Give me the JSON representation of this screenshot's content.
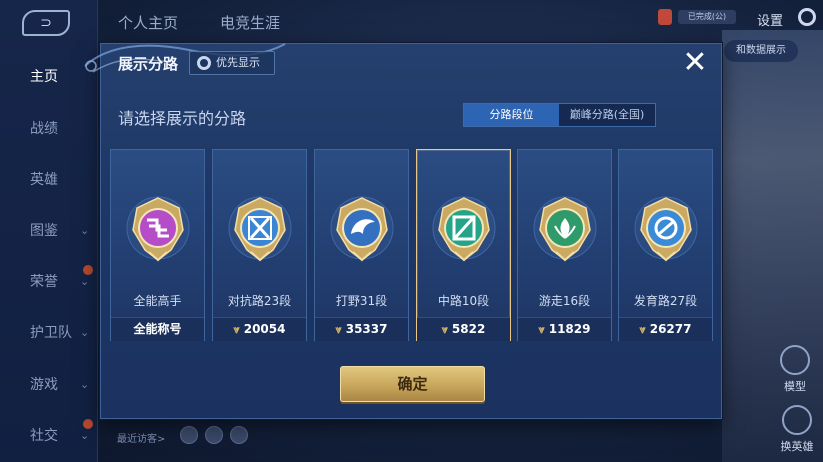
{
  "nav": {
    "back_symbol": "⊃",
    "items": [
      {
        "label": "主页",
        "active": true,
        "chevron": false,
        "dot": false
      },
      {
        "label": "战绩",
        "active": false,
        "chevron": false,
        "dot": false
      },
      {
        "label": "英雄",
        "active": false,
        "chevron": false,
        "dot": false
      },
      {
        "label": "图鉴",
        "active": false,
        "chevron": true,
        "dot": false
      },
      {
        "label": "荣誉",
        "active": false,
        "chevron": true,
        "dot": true
      },
      {
        "label": "护卫队",
        "active": false,
        "chevron": true,
        "dot": false
      },
      {
        "label": "游戏",
        "active": false,
        "chevron": true,
        "dot": false
      },
      {
        "label": "社交",
        "active": false,
        "chevron": true,
        "dot": true
      }
    ]
  },
  "top_tabs": [
    "个人主页",
    "电竞生涯"
  ],
  "top_right": {
    "mini_label": "已完成(公)",
    "settings_label": "设置",
    "badge_text": "和数据展示"
  },
  "right_panel": {
    "model_label": "模型",
    "swap_label": "换英雄"
  },
  "footer": {
    "visitors_label": "最近访客>"
  },
  "modal": {
    "title": "展示分路",
    "priority_label": "优先显示",
    "close_symbol": "✕",
    "subtitle": "请选择展示的分路",
    "segments": {
      "selected": "分路段位",
      "other": "巅峰分路(全国)"
    },
    "cards": [
      {
        "name": "全能高手",
        "points": "全能称号",
        "show_chevron": false,
        "emblem": "all-round-emblem-icon",
        "gem": "#b54cc8",
        "selected": false
      },
      {
        "name": "对抗路23段",
        "points": "20054",
        "show_chevron": true,
        "emblem": "clash-lane-emblem-icon",
        "gem": "#3a86d4",
        "selected": false
      },
      {
        "name": "打野31段",
        "points": "35337",
        "show_chevron": true,
        "emblem": "jungle-emblem-icon",
        "gem": "#3470c0",
        "selected": false
      },
      {
        "name": "中路10段",
        "points": "5822",
        "show_chevron": true,
        "emblem": "mid-lane-emblem-icon",
        "gem": "#26a48a",
        "selected": true
      },
      {
        "name": "游走16段",
        "points": "11829",
        "show_chevron": true,
        "emblem": "roam-emblem-icon",
        "gem": "#2f9a6a",
        "selected": false
      },
      {
        "name": "发育路27段",
        "points": "26277",
        "show_chevron": true,
        "emblem": "farm-lane-emblem-icon",
        "gem": "#3a8ad8",
        "selected": false
      }
    ],
    "confirm_label": "确定"
  },
  "colors": {
    "gold": "#e7c889",
    "accent_blue": "#2d64b3"
  }
}
